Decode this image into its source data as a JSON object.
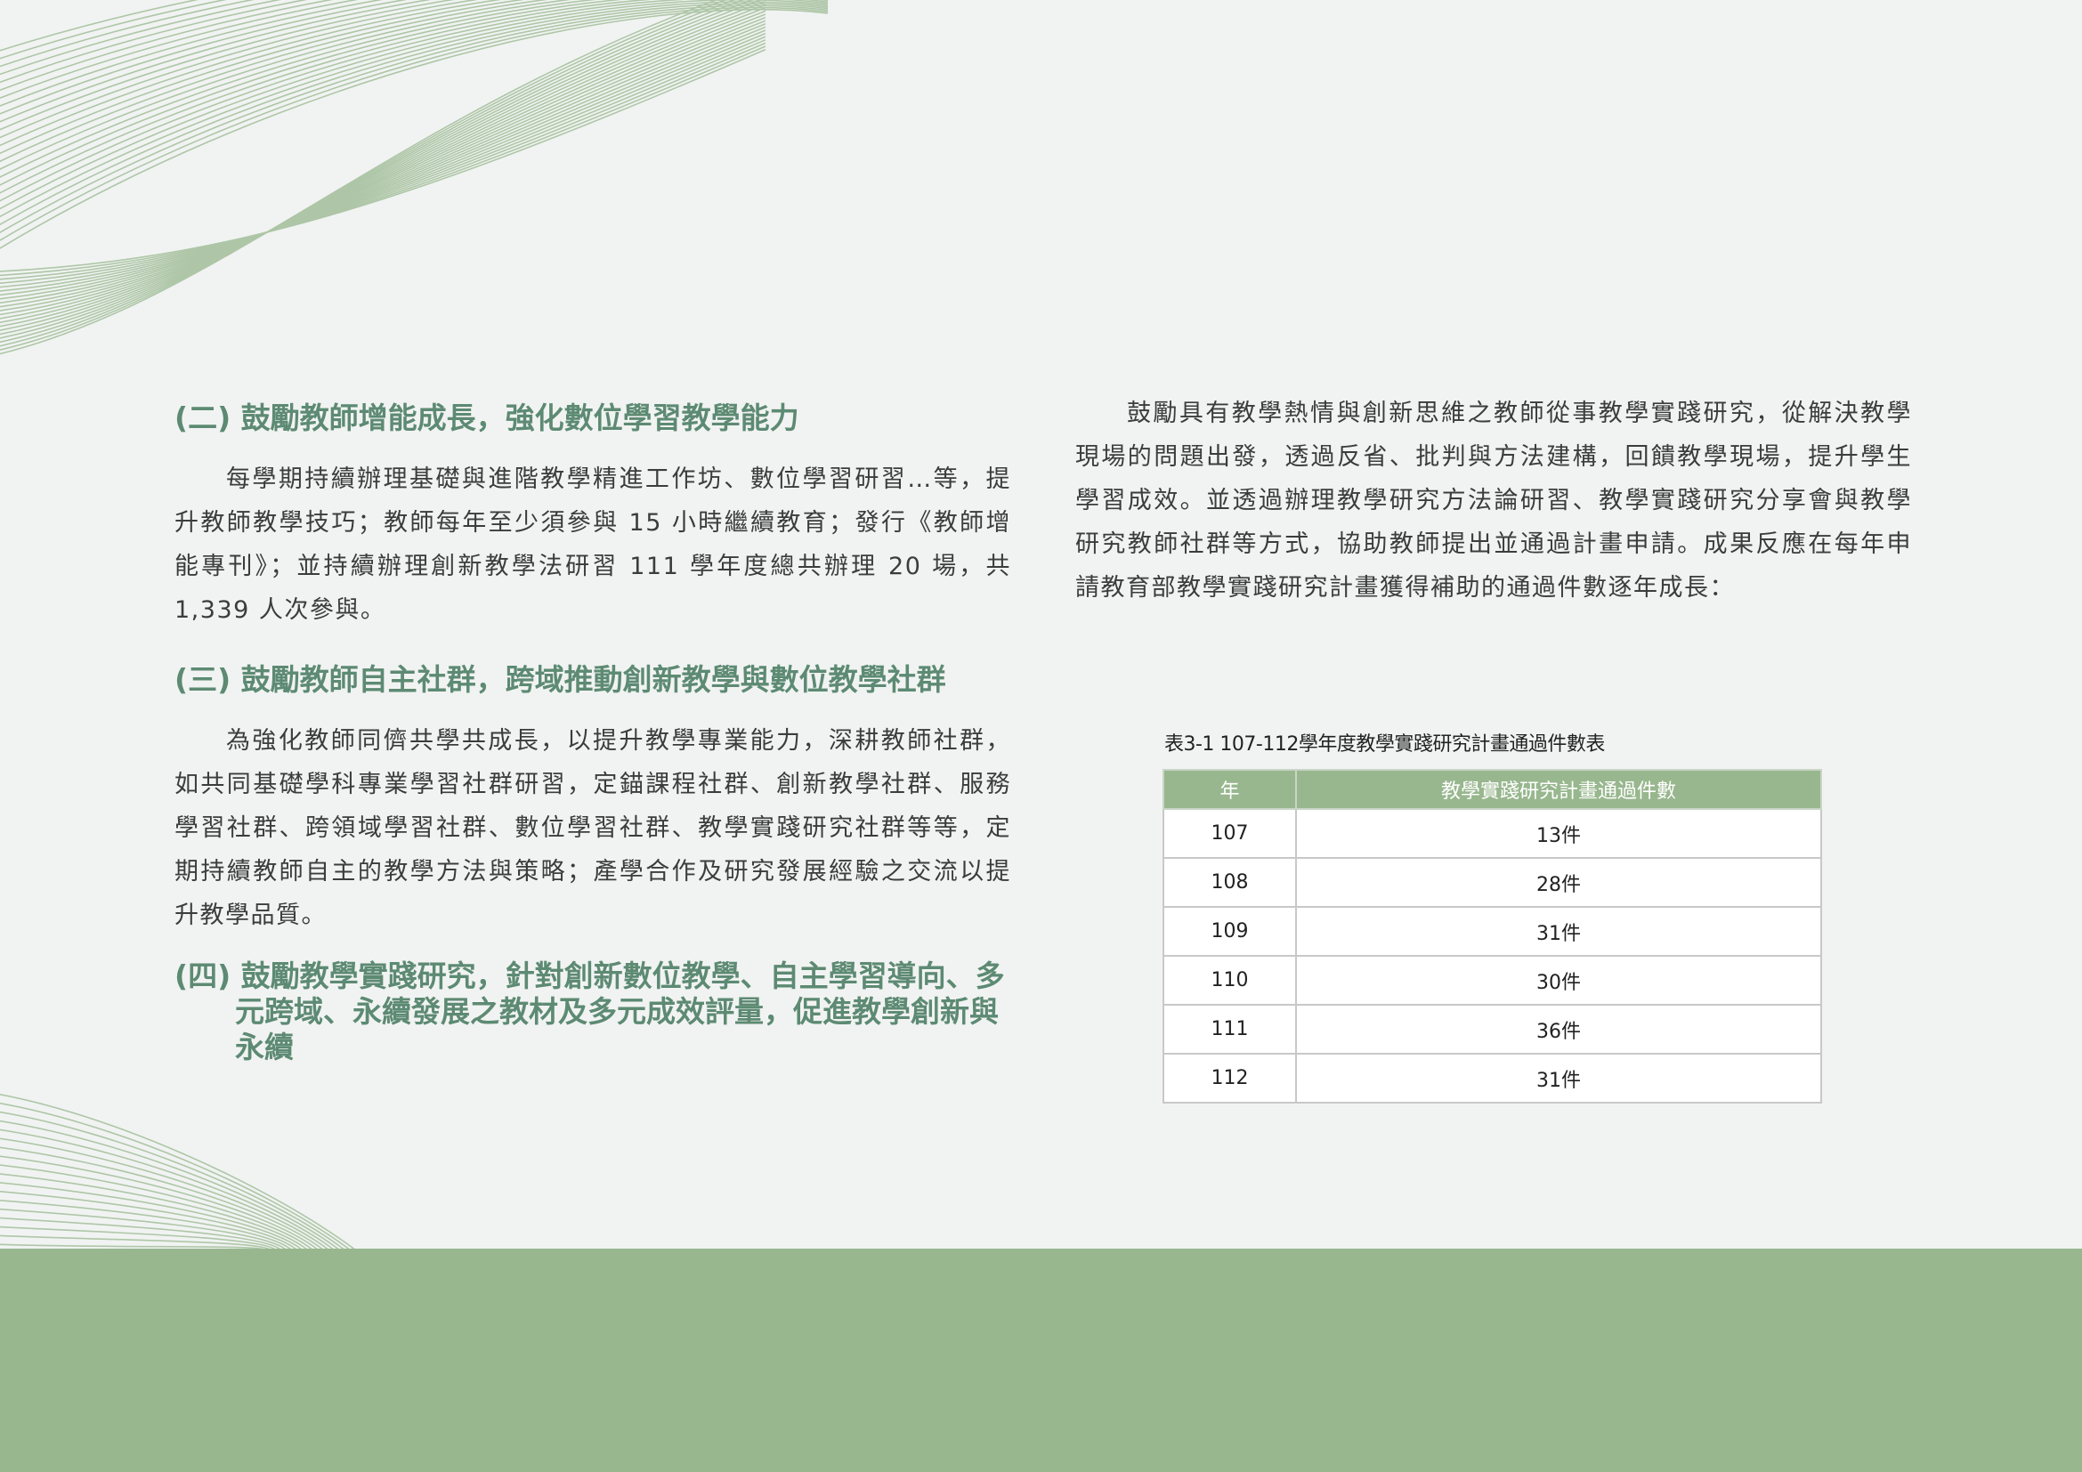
{
  "left": {
    "section2": {
      "heading": "(二) 鼓勵教師增能成長，強化數位學習教學能力",
      "paragraph": "每學期持續辦理基礎與進階教學精進工作坊、數位學習研習…等，提升教師教學技巧；教師每年至少須參與 15 小時繼續教育；發行《教師增能專刊》；並持續辦理創新教學法研習 111 學年度總共辦理 20 場，共 1,339 人次參與。"
    },
    "section3": {
      "heading": "(三) 鼓勵教師自主社群，跨域推動創新教學與數位教學社群",
      "paragraph": "為強化教師同儕共學共成長，以提升教學專業能力，深耕教師社群，如共同基礎學科專業學習社群研習，定錨課程社群、創新教學社群、服務學習社群、跨領域學習社群、數位學習社群、教學實踐研究社群等等，定期持續教師自主的教學方法與策略；產學合作及研究發展經驗之交流以提升教學品質。"
    },
    "section4": {
      "heading": "(四) 鼓勵教學實踐研究，針對創新數位教學、自主學習導向、多元跨域、永續發展之教材及多元成效評量，促進教學創新與永續"
    }
  },
  "right": {
    "paragraph": "鼓勵具有教學熱情與創新思維之教師從事教學實踐研究，從解決教學現場的問題出發，透過反省、批判與方法建構，回饋教學現場，提升學生學習成效。並透過辦理教學研究方法論研習、教學實踐研究分享會與教學研究教師社群等方式，協助教師提出並通過計畫申請。成果反應在每年申請教育部教學實踐研究計畫獲得補助的通過件數逐年成長："
  },
  "table": {
    "caption": "表3-1 107-112學年度教學實踐研究計畫通過件數表",
    "headers": [
      "年",
      "教學實踐研究計畫通過件數"
    ],
    "rows": [
      {
        "year": "107",
        "count": "13件"
      },
      {
        "year": "108",
        "count": "28件"
      },
      {
        "year": "109",
        "count": "31件"
      },
      {
        "year": "110",
        "count": "30件"
      },
      {
        "year": "111",
        "count": "36件"
      },
      {
        "year": "112",
        "count": "31件"
      }
    ]
  },
  "colors": {
    "heading": "#5d8a73",
    "accent": "#98b78e",
    "background": "#f1f3f2"
  }
}
